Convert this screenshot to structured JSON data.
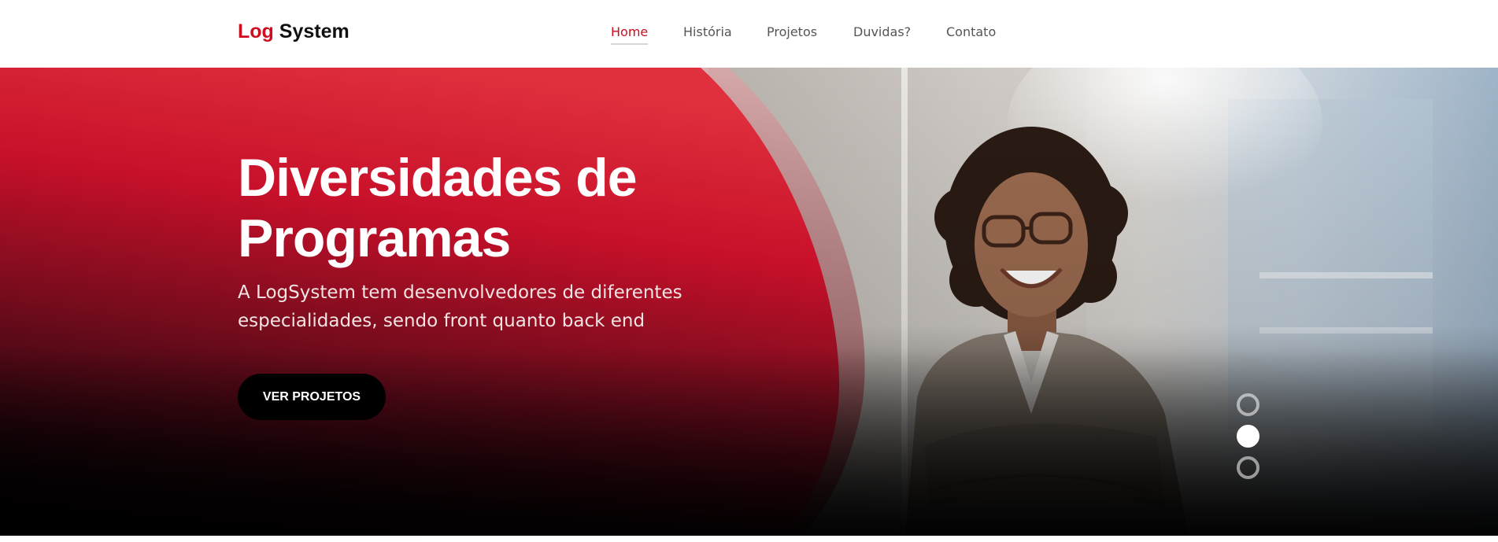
{
  "header": {
    "logo_accent": "Log",
    "logo_rest": "System",
    "nav": [
      {
        "label": "Home",
        "active": true
      },
      {
        "label": "História",
        "active": false
      },
      {
        "label": "Projetos",
        "active": false
      },
      {
        "label": "Duvidas?",
        "active": false
      },
      {
        "label": "Contato",
        "active": false
      }
    ]
  },
  "hero": {
    "title_line1": "Diversidades de",
    "title_line2": "Programas",
    "subtitle_line1": "A LogSystem tem desenvolvedores de diferentes",
    "subtitle_line2": "especialidades, sendo front quanto back end",
    "cta_label": "VER PROJETOS",
    "carousel": {
      "total": 3,
      "active_index": 1
    }
  },
  "colors": {
    "brand_red": "#cf0d1e",
    "dark": "#000000",
    "nav_text": "#555555"
  },
  "icons": [
    "carousel-dot-icon",
    "person-photo"
  ]
}
